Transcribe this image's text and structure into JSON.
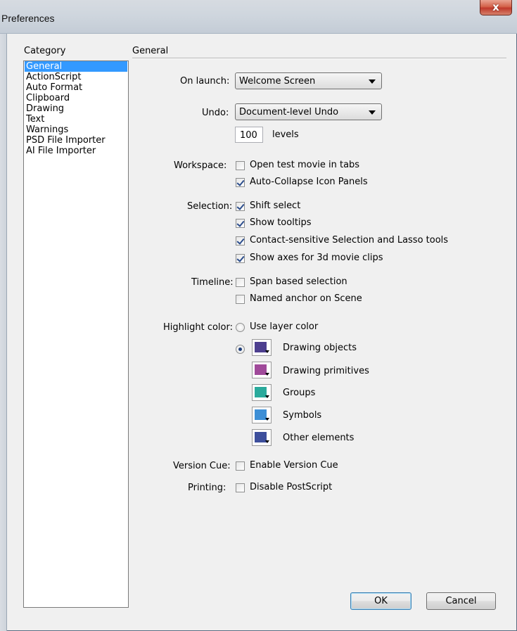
{
  "window": {
    "title": "Preferences",
    "close_glyph": "x"
  },
  "category": {
    "label": "Category",
    "items": [
      "General",
      "ActionScript",
      "Auto Format",
      "Clipboard",
      "Drawing",
      "Text",
      "Warnings",
      "PSD File Importer",
      "AI File Importer"
    ],
    "selected": "General"
  },
  "general": {
    "heading": "General",
    "on_launch": {
      "label": "On launch:",
      "value": "Welcome Screen"
    },
    "undo": {
      "label": "Undo:",
      "value": "Document-level Undo",
      "levels_value": "100",
      "levels_label": "levels"
    },
    "workspace": {
      "label": "Workspace:",
      "options": [
        {
          "text": "Open test movie in tabs",
          "checked": false
        },
        {
          "text": "Auto-Collapse Icon Panels",
          "checked": true
        }
      ]
    },
    "selection": {
      "label": "Selection:",
      "options": [
        {
          "text": "Shift select",
          "checked": true
        },
        {
          "text": "Show tooltips",
          "checked": true
        },
        {
          "text": "Contact-sensitive Selection and Lasso tools",
          "checked": true
        },
        {
          "text": "Show axes for 3d movie clips",
          "checked": true
        }
      ]
    },
    "timeline": {
      "label": "Timeline:",
      "options": [
        {
          "text": "Span based selection",
          "checked": false
        },
        {
          "text": "Named anchor on Scene",
          "checked": false
        }
      ]
    },
    "highlight": {
      "label": "Highlight color:",
      "use_layer_color": "Use layer color",
      "use_layer_selected": false,
      "custom_selected": true,
      "swatches": [
        {
          "text": "Drawing objects",
          "color": "#4d3f8f"
        },
        {
          "text": "Drawing primitives",
          "color": "#a04a9a"
        },
        {
          "text": "Groups",
          "color": "#2aaa9c"
        },
        {
          "text": "Symbols",
          "color": "#3d8fd6"
        },
        {
          "text": "Other elements",
          "color": "#3d4f9c"
        }
      ]
    },
    "version_cue": {
      "label": "Version Cue:",
      "text": "Enable Version Cue",
      "checked": false
    },
    "printing": {
      "label": "Printing:",
      "text": "Disable PostScript",
      "checked": false
    }
  },
  "buttons": {
    "ok": "OK",
    "cancel": "Cancel"
  }
}
